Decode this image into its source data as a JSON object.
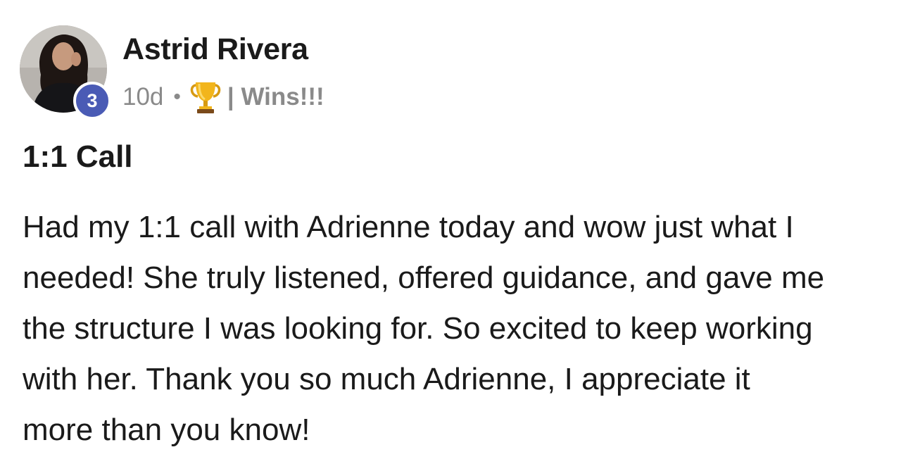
{
  "author": {
    "name": "Astrid Rivera",
    "level": "3"
  },
  "meta": {
    "time_ago": "10d",
    "separator": "•",
    "category_icon": "trophy-icon",
    "category": "| Wins!!!"
  },
  "post": {
    "title": "1:1 Call",
    "body_lines": [
      "Had my 1:1 call with Adrienne today and wow just what I",
      "needed! She truly listened, offered guidance, and gave me",
      "the structure I was looking for. So excited to keep working",
      "with her. Thank you so much Adrienne, I appreciate it",
      "more than you know!"
    ]
  },
  "colors": {
    "level_badge": "#4a5bb5",
    "meta_text": "#8a8a8a",
    "primary_text": "#1a1a1a"
  }
}
